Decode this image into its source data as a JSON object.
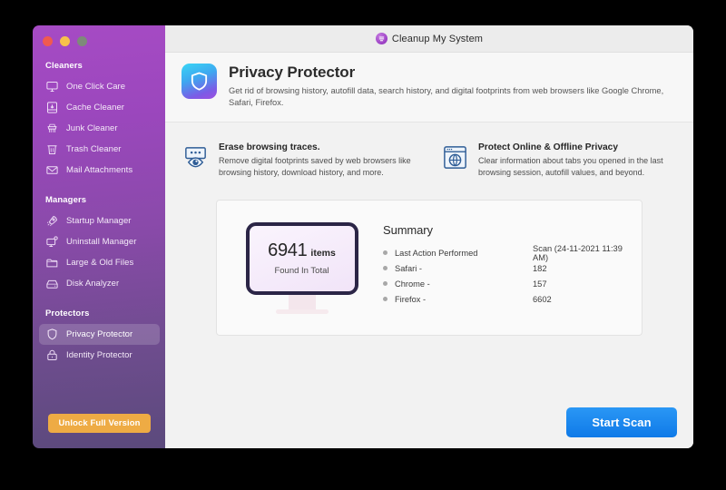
{
  "window": {
    "traffic_lights": [
      "close",
      "minimize",
      "zoom"
    ],
    "app_title": "Cleanup My System",
    "app_logo_icon": "cleanup-logo-icon"
  },
  "sidebar": {
    "groups": [
      {
        "label": "Cleaners",
        "items": [
          {
            "label": "One Click Care",
            "icon": "monitor-icon",
            "selected": false
          },
          {
            "label": "Cache Cleaner",
            "icon": "cache-box-icon",
            "selected": false
          },
          {
            "label": "Junk Cleaner",
            "icon": "brush-icon",
            "selected": false
          },
          {
            "label": "Trash Cleaner",
            "icon": "trash-icon",
            "selected": false
          },
          {
            "label": "Mail Attachments",
            "icon": "envelope-icon",
            "selected": false
          }
        ]
      },
      {
        "label": "Managers",
        "items": [
          {
            "label": "Startup Manager",
            "icon": "rocket-icon",
            "selected": false
          },
          {
            "label": "Uninstall Manager",
            "icon": "monitor-badge-icon",
            "selected": false
          },
          {
            "label": "Large & Old Files",
            "icon": "folder-icon",
            "selected": false
          },
          {
            "label": "Disk Analyzer",
            "icon": "disk-drive-icon",
            "selected": false
          }
        ]
      },
      {
        "label": "Protectors",
        "items": [
          {
            "label": "Privacy Protector",
            "icon": "shield-icon",
            "selected": true
          },
          {
            "label": "Identity Protector",
            "icon": "lock-icon",
            "selected": false
          }
        ]
      }
    ],
    "unlock_label": "Unlock Full Version",
    "unlock_color": "#eeab44"
  },
  "header": {
    "icon": "shield-app-icon",
    "title": "Privacy Protector",
    "subtitle": "Get rid of browsing history, autofill data, search history, and digital footprints from web browsers like Google Chrome, Safari, Firefox."
  },
  "features": [
    {
      "icon": "eye-screen-icon",
      "title": "Erase browsing traces.",
      "desc": "Remove digital footprints saved by web browsers like browsing history, download history, and more."
    },
    {
      "icon": "browser-globe-icon",
      "title": "Protect Online & Offline Privacy",
      "desc": "Clear information about tabs you opened in the last browsing session, autofill values, and beyond."
    }
  ],
  "summary_card": {
    "monitor": {
      "count": "6941",
      "unit": "items",
      "caption": "Found In Total"
    },
    "heading": "Summary",
    "rows": [
      {
        "key": "Last Action Performed",
        "value": "Scan (24-11-2021 11:39 AM)"
      },
      {
        "key": "Safari -",
        "value": "182"
      },
      {
        "key": "Chrome -",
        "value": "157"
      },
      {
        "key": "Firefox -",
        "value": "6602"
      }
    ]
  },
  "footer": {
    "start_scan_label": "Start Scan",
    "start_scan_color": "#1283ec"
  }
}
